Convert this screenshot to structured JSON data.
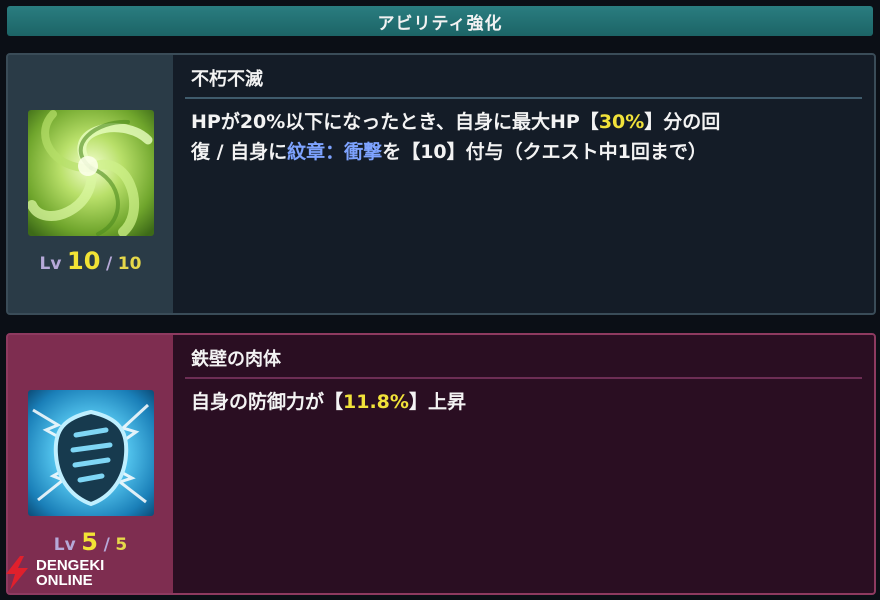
{
  "header": {
    "title": "アビリティ強化"
  },
  "abilities": [
    {
      "name": "不朽不滅",
      "desc": {
        "line1_a": "HPが20%以下になったとき、自身に最大HP【",
        "line1_hl": "30%",
        "line1_b": "】分の回",
        "line2_a": "復 / 自身に",
        "line2_hl": "紋章：衝撃",
        "line2_b": "を【10】付与（クエスト中1回まで）"
      },
      "icon": "green-swirl-icon",
      "level": {
        "label": "Lv",
        "current": "10",
        "slash": "/",
        "max": "10"
      }
    },
    {
      "name": "鉄壁の肉体",
      "desc": {
        "line1_a": "自身の防御力が【",
        "line1_hl": "11.8%",
        "line1_b": "】上昇"
      },
      "icon": "blue-shield-icon",
      "level": {
        "label": "Lv",
        "current": "5",
        "slash": "/",
        "max": "5"
      }
    }
  ],
  "watermark": {
    "line1": "DENGEKI",
    "line2": "ONLINE"
  },
  "colors": {
    "highlight_yellow": "#f1e23a",
    "highlight_blue": "#7ea3ff"
  }
}
